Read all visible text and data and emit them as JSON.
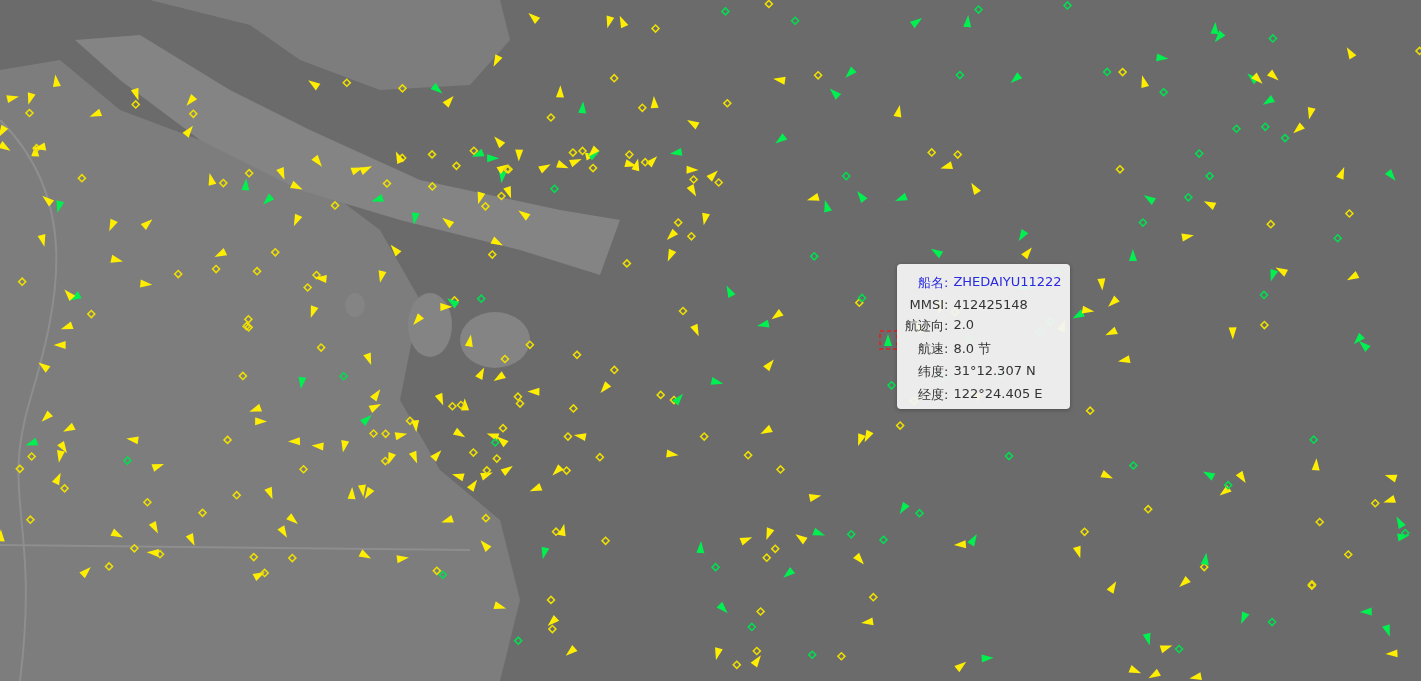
{
  "map": {
    "tooltip": {
      "rows": [
        {
          "kind": "name",
          "label": "船名:",
          "value": "ZHEDAIYU11222"
        },
        {
          "kind": "plain",
          "label": "MMSI:",
          "value": "412425148"
        },
        {
          "kind": "plain",
          "label": "航迹向:",
          "value": "2.0"
        },
        {
          "kind": "plain",
          "label": "航速:",
          "value": "8.0 节"
        },
        {
          "kind": "plain",
          "label": "纬度:",
          "value": "31°12.307 N"
        },
        {
          "kind": "plain",
          "label": "经度:",
          "value": "122°24.405 E"
        }
      ]
    }
  }
}
